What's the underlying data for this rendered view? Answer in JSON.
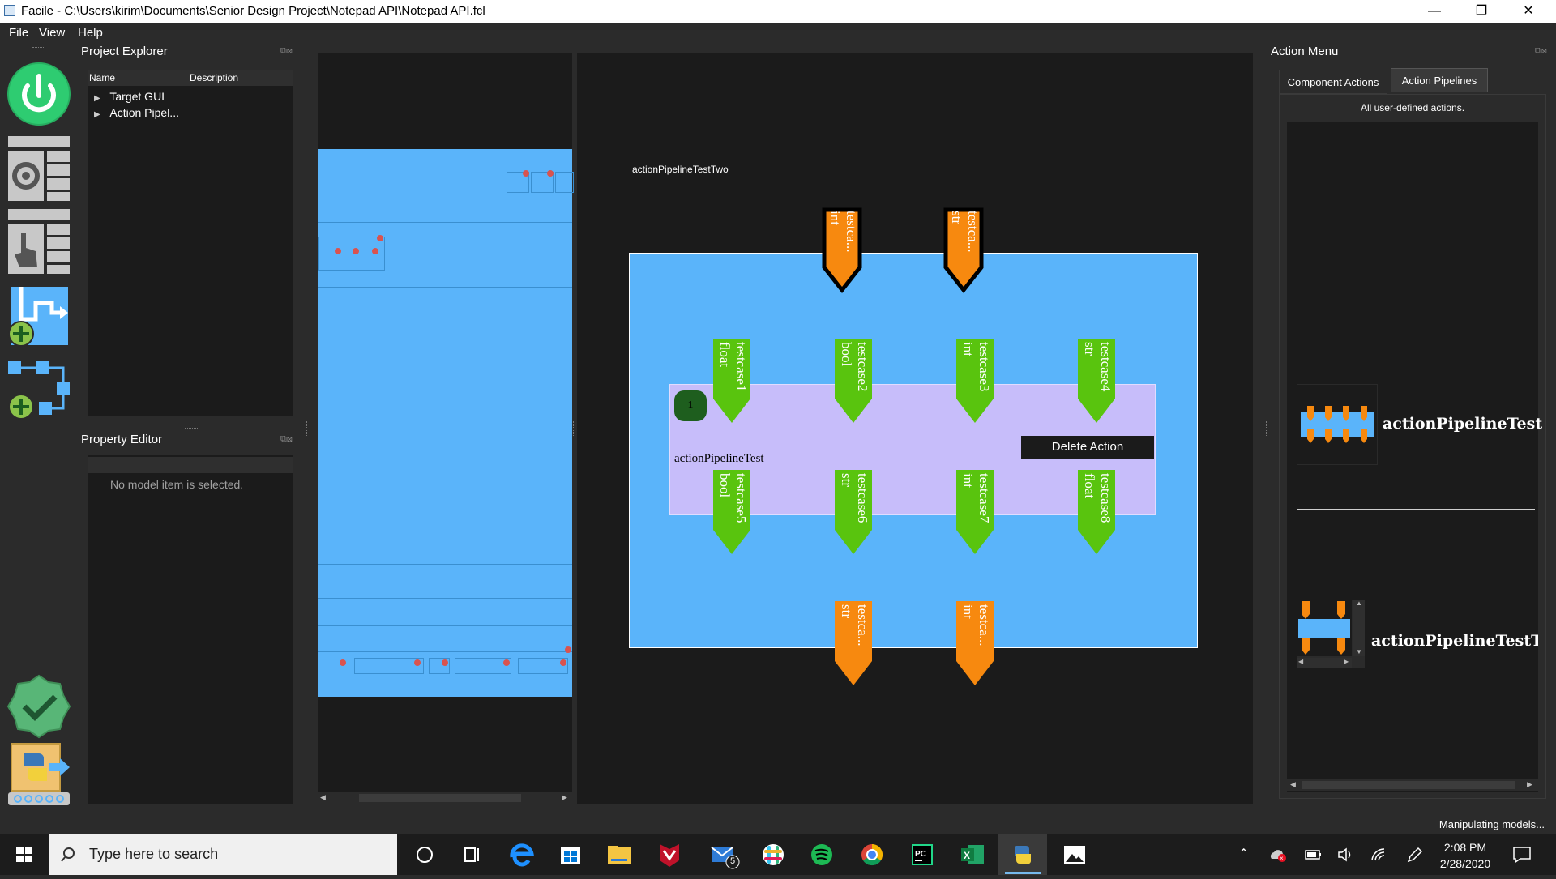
{
  "window": {
    "title": "Facile - C:\\Users\\kirim\\Documents\\Senior Design Project\\Notepad API\\Notepad API.fcl",
    "minimize": "—",
    "maximize": "❐",
    "close": "✕"
  },
  "menubar": {
    "items": [
      "File",
      "View",
      "Help"
    ]
  },
  "toolbar": {
    "icons": [
      "power-icon",
      "target-gui-settings-icon",
      "target-gui-pointer-icon",
      "add-action-pipeline-icon",
      "add-component-pipeline-icon",
      "validate-checkmark-icon",
      "python-export-icon"
    ]
  },
  "project_explorer": {
    "title": "Project Explorer",
    "col_name": "Name",
    "col_description": "Description",
    "items": [
      "Target GUI",
      "Action Pipel..."
    ]
  },
  "property_editor": {
    "title": "Property Editor",
    "empty_message": "No model item is selected."
  },
  "canvas": {
    "pipeline_title": "actionPipelineTestTwo",
    "inner_action_name": "actionPipelineTest",
    "action_index": "1",
    "context_menu_item": "Delete Action",
    "top_ports": [
      {
        "name": "testca...",
        "type": "int"
      },
      {
        "name": "testca...",
        "type": "str"
      }
    ],
    "inner_inputs": [
      {
        "name": "testcase1",
        "type": "float"
      },
      {
        "name": "testcase2",
        "type": "bool"
      },
      {
        "name": "testcase3",
        "type": "int"
      },
      {
        "name": "testcase4",
        "type": "str"
      }
    ],
    "inner_outputs": [
      {
        "name": "testcase5",
        "type": "bool"
      },
      {
        "name": "testcase6",
        "type": "str"
      },
      {
        "name": "testcase7",
        "type": "int"
      },
      {
        "name": "testcase8",
        "type": "float"
      }
    ],
    "bottom_ports": [
      {
        "name": "testca...",
        "type": "str"
      },
      {
        "name": "testca...",
        "type": "int"
      }
    ],
    "colors": {
      "pipeline_bg": "#5ab4fa",
      "action_bg": "#c7bdfa",
      "input_port": "#f7890f",
      "inner_port": "#59c40e"
    }
  },
  "action_menu": {
    "title": "Action Menu",
    "tabs": [
      "Component Actions",
      "Action Pipelines"
    ],
    "active_tab": "Action Pipelines",
    "description": "All user-defined actions.",
    "items": [
      {
        "label": "actionPipelineTest"
      },
      {
        "label": "actionPipelineTestTw"
      }
    ]
  },
  "statusbar": {
    "message": "Manipulating models..."
  },
  "taskbar": {
    "search_placeholder": "Type here to search",
    "time": "2:08 PM",
    "date": "2/28/2020",
    "mail_badge": "5"
  }
}
